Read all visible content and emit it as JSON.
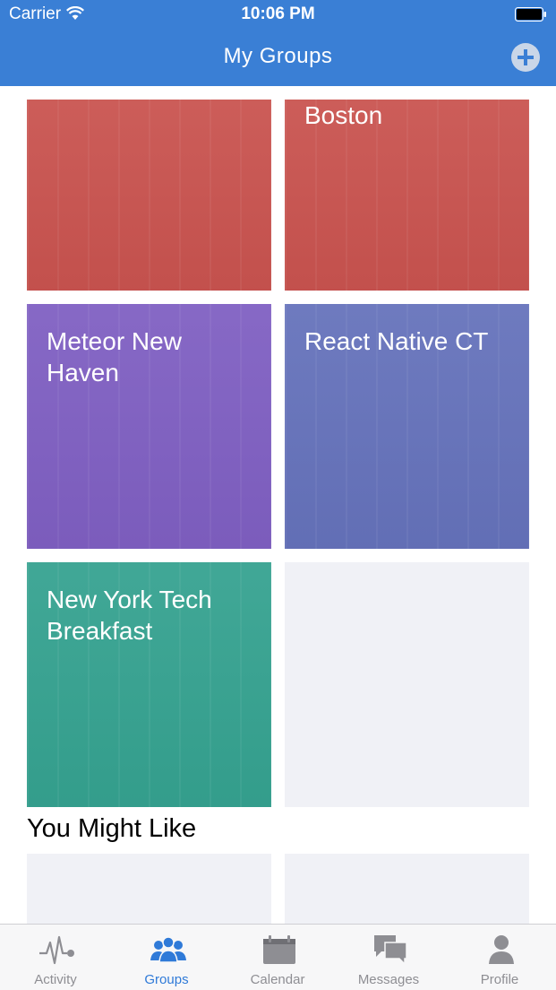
{
  "status_bar": {
    "carrier": "Carrier",
    "time": "10:06 PM",
    "wifi_icon": "wifi-icon",
    "battery_icon": "battery-icon"
  },
  "nav": {
    "title": "My Groups",
    "add_icon": "plus-circle-icon",
    "color": "#3a7fd5"
  },
  "groups": [
    {
      "title": "",
      "color": "#c9534f"
    },
    {
      "title": "Boston",
      "color": "#c9534f"
    },
    {
      "title": "Meteor New Haven",
      "color": "#7f5fc2"
    },
    {
      "title": "React Native CT",
      "color": "#6572bb"
    },
    {
      "title": "New York Tech Breakfast",
      "color": "#35a290"
    }
  ],
  "placeholder_color": "#f0f1f6",
  "suggestions": {
    "title": "You Might Like"
  },
  "tab_bar": {
    "items": [
      {
        "label": "Activity",
        "icon": "pulse-icon",
        "active": false
      },
      {
        "label": "Groups",
        "icon": "people-icon",
        "active": true
      },
      {
        "label": "Calendar",
        "icon": "calendar-icon",
        "active": false
      },
      {
        "label": "Messages",
        "icon": "chat-bubbles-icon",
        "active": false
      },
      {
        "label": "Profile",
        "icon": "person-icon",
        "active": false
      }
    ],
    "active_color": "#2f7ad8",
    "inactive_color": "#8e8e93"
  }
}
